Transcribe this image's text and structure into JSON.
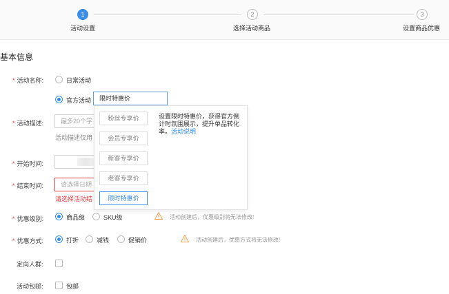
{
  "steps": [
    {
      "num": "1",
      "label": "活动设置",
      "state": "active"
    },
    {
      "num": "2",
      "label": "选择活动商品",
      "state": "todo"
    },
    {
      "num": "3",
      "label": "设置商品优惠",
      "state": "todo"
    }
  ],
  "section_title": "基本信息",
  "form": {
    "required_mark": "*",
    "name": {
      "label": "活动名称:",
      "opt_daily": "日常活动",
      "opt_official": "官方活动",
      "selected_value": "限时特惠价"
    },
    "desc": {
      "label": "活动描述:",
      "placeholder": "最多20个字",
      "hint": "活动描述仅用"
    },
    "start": {
      "label": "开始时间:"
    },
    "end": {
      "label": "结束时间:",
      "placeholder": "请选择日期",
      "error": "请选择活动结"
    },
    "level": {
      "label": "优惠级别:",
      "opt_item": "商品级",
      "opt_sku": "SKU级",
      "warning": "活动创建后，优惠级别将无法修改!"
    },
    "method": {
      "label": "优惠方式:",
      "opt_discount": "打折",
      "opt_reduce": "减钱",
      "opt_promo": "促销价",
      "warning": "活动创建后，优惠方式将无法修改!"
    },
    "target": {
      "label": "定向人群:"
    },
    "shipping": {
      "label": "活动包邮:",
      "opt": "包邮"
    }
  },
  "popup": {
    "items": [
      "粉丝专享价",
      "会员专享价",
      "新客专享价",
      "老客专享价",
      "限时特惠价"
    ],
    "selected_index": 4,
    "desc_line1": "设置限时特惠价，获得官方倒",
    "desc_line2": "计时氛围展示，提升单品转化",
    "desc_line3": "率。",
    "desc_link": "活动说明"
  },
  "colors": {
    "primary": "#3a8ee6",
    "error": "#e4393c",
    "warning": "#f0a04b"
  }
}
